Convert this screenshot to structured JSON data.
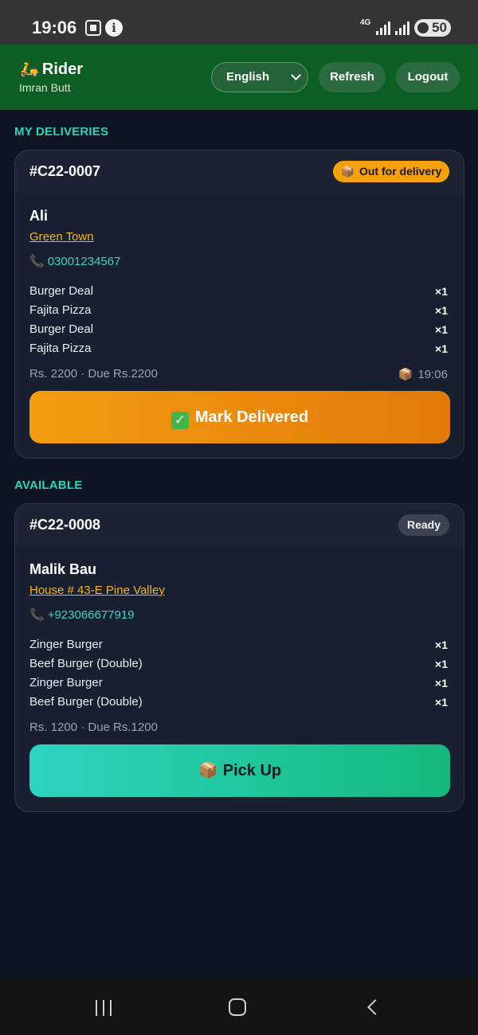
{
  "status_bar": {
    "time": "19:06",
    "network": "4G",
    "battery": "50"
  },
  "header": {
    "brand_icon": "🛵",
    "title": "Rider",
    "rider_name": "Imran Butt",
    "language": "English",
    "refresh_label": "Refresh",
    "logout_label": "Logout"
  },
  "sections": {
    "my_deliveries": "MY DELIVERIES",
    "available": "AVAILABLE"
  },
  "delivery": {
    "order_id": "#C22-0007",
    "badge": "Out for delivery",
    "customer": "Ali",
    "address": "Green Town",
    "phone": "03001234567",
    "items": [
      {
        "name": "Burger Deal",
        "qty": "×1"
      },
      {
        "name": "Fajita Pizza",
        "qty": "×1"
      },
      {
        "name": "Burger Deal",
        "qty": "×1"
      },
      {
        "name": "Fajita Pizza",
        "qty": "×1"
      }
    ],
    "totals": "Rs. 2200 · Due Rs.2200",
    "time": "19:06",
    "action_label": "Mark Delivered"
  },
  "available_order": {
    "order_id": "#C22-0008",
    "badge": "Ready",
    "customer": "Malik Bau",
    "address": "House # 43-E Pine Valley",
    "phone": "+923066677919",
    "items": [
      {
        "name": "Zinger Burger",
        "qty": "×1"
      },
      {
        "name": "Beef Burger (Double)",
        "qty": "×1"
      },
      {
        "name": "Zinger Burger",
        "qty": "×1"
      },
      {
        "name": "Beef Burger (Double)",
        "qty": "×1"
      }
    ],
    "totals": "Rs. 1200 · Due Rs.1200",
    "action_label": "Pick Up"
  },
  "colors": {
    "header_bg": "#0b5e24",
    "accent_teal": "#2fd3b8",
    "accent_orange": "#f5a00c",
    "background": "#0d1422"
  }
}
